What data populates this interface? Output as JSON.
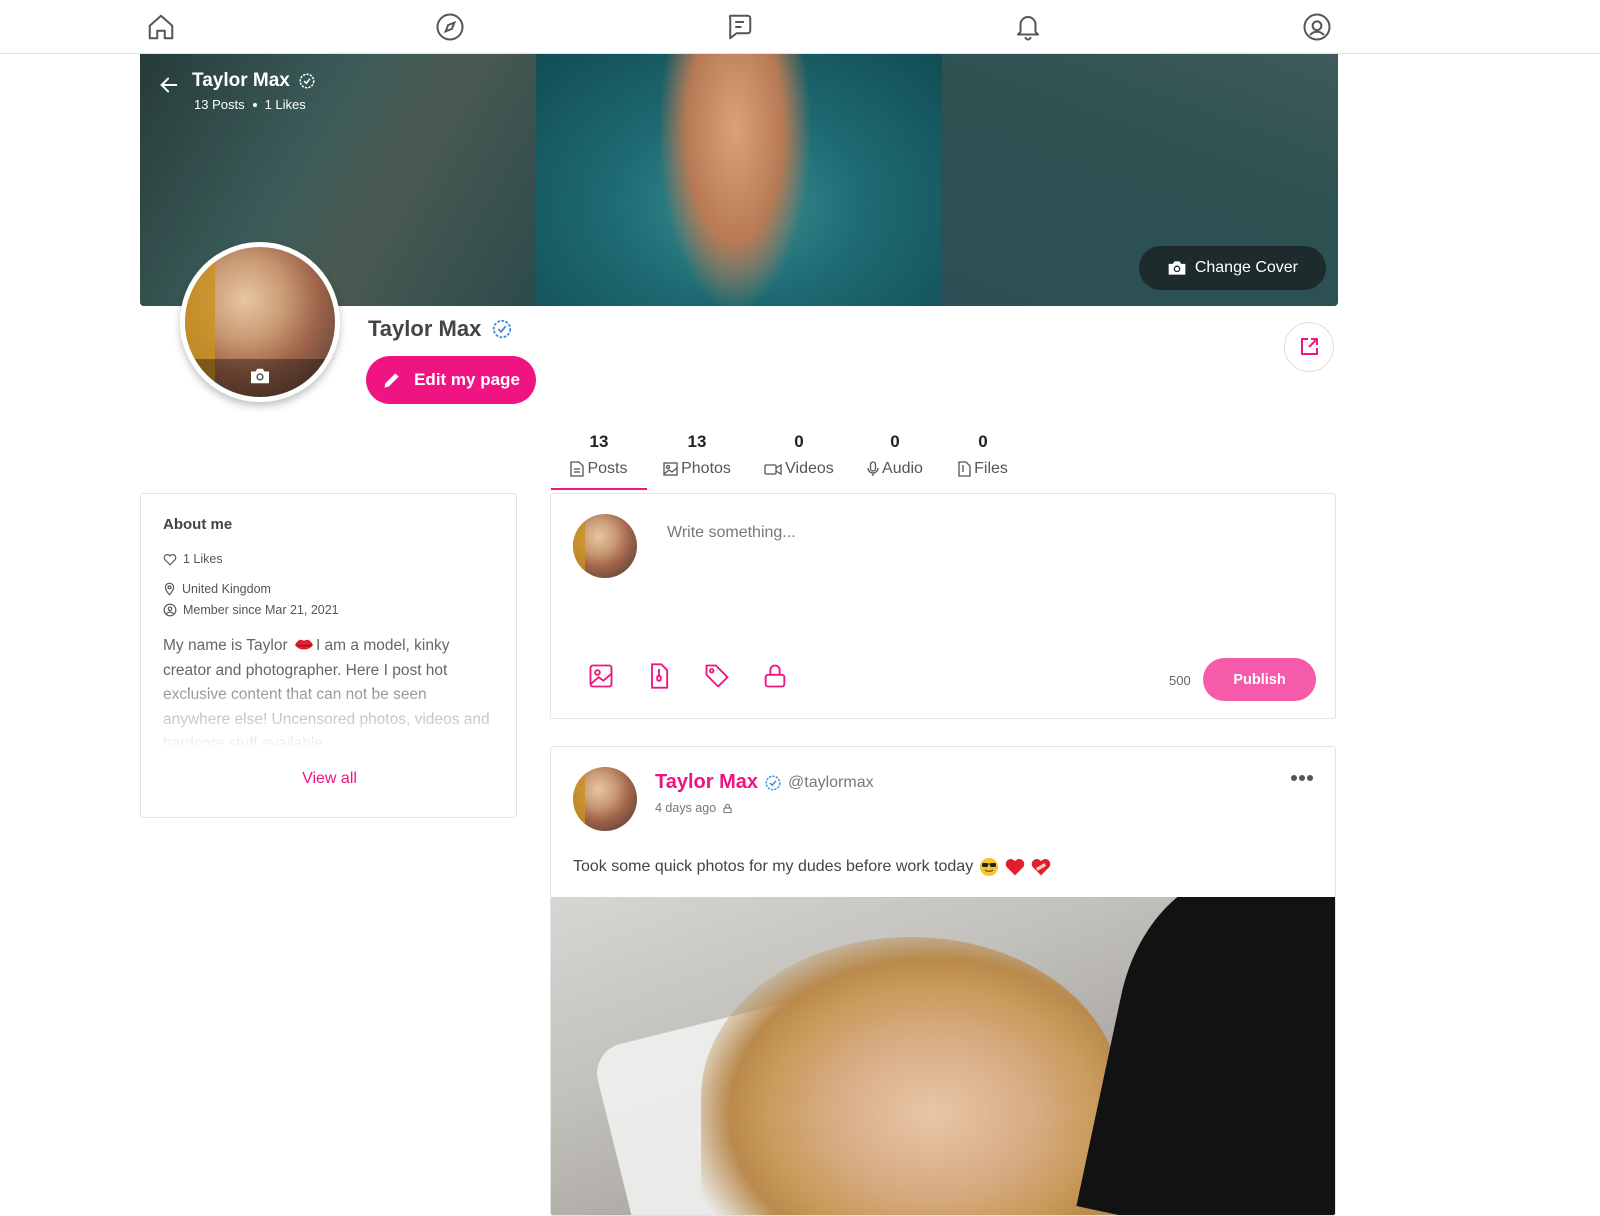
{
  "nav": {
    "items": [
      "home-icon",
      "explore-icon",
      "messages-icon",
      "notifications-icon",
      "account-icon"
    ]
  },
  "cover": {
    "name": "Taylor Max",
    "posts_stat": "13 Posts",
    "likes_stat": "1 Likes",
    "change_cover_label": "Change Cover"
  },
  "profile": {
    "name": "Taylor Max",
    "edit_label": "Edit my page"
  },
  "tabs": [
    {
      "count": "13",
      "label": "Posts",
      "active": true
    },
    {
      "count": "13",
      "label": "Photos"
    },
    {
      "count": "0",
      "label": "Videos"
    },
    {
      "count": "0",
      "label": "Audio"
    },
    {
      "count": "0",
      "label": "Files"
    }
  ],
  "about": {
    "title": "About me",
    "likes": "1 Likes",
    "location": "United Kingdom",
    "member_since": "Member since Mar 21, 2021",
    "bio_part1": "My name is Taylor",
    "bio_part2": "I am a model, kinky creator and photographer. Here I post hot exclusive content that can not be seen anywhere else! Uncensored photos, videos and hardcore stuff available",
    "view_all": "View all"
  },
  "composer": {
    "placeholder": "Write something...",
    "char_count": "500",
    "publish_label": "Publish"
  },
  "post": {
    "author": "Taylor Max",
    "handle": "@taylormax",
    "time": "4 days ago",
    "text": "Took some quick photos for my dudes before work today"
  },
  "colors": {
    "accent": "#f01482",
    "publish": "#f55ba9",
    "verified": "#3b8fe0"
  }
}
